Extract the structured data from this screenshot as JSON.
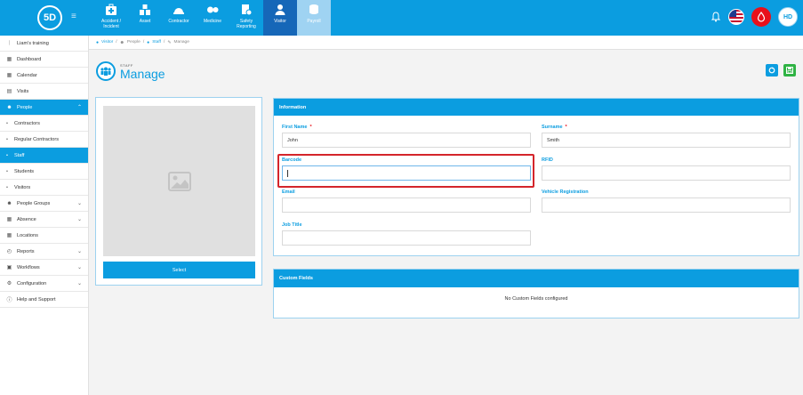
{
  "app": {
    "logo_text": "5D"
  },
  "modules": [
    {
      "id": "accident",
      "label_line1": "Accident /",
      "label_line2": "Incident"
    },
    {
      "id": "asset",
      "label_line1": "Asset",
      "label_line2": ""
    },
    {
      "id": "contractor",
      "label_line1": "Contractor",
      "label_line2": ""
    },
    {
      "id": "medicine",
      "label_line1": "Medicine",
      "label_line2": ""
    },
    {
      "id": "safety",
      "label_line1": "Safety",
      "label_line2": "Reporting"
    },
    {
      "id": "visitor",
      "label_line1": "Visitor",
      "label_line2": ""
    },
    {
      "id": "payroll",
      "label_line1": "Payroll",
      "label_line2": ""
    }
  ],
  "user": {
    "initials": "HD"
  },
  "sidebar": {
    "items": [
      {
        "label": "Liam's training",
        "icon": "branch-icon"
      },
      {
        "label": "Dashboard",
        "icon": "dashboard-icon"
      },
      {
        "label": "Calendar",
        "icon": "calendar-icon"
      },
      {
        "label": "Visits",
        "icon": "visits-icon"
      },
      {
        "label": "People",
        "icon": "people-icon"
      },
      {
        "label": "Contractors"
      },
      {
        "label": "Regular Contractors"
      },
      {
        "label": "Staff"
      },
      {
        "label": "Students"
      },
      {
        "label": "Visitors"
      },
      {
        "label": "People Groups",
        "icon": "groups-icon"
      },
      {
        "label": "Absence",
        "icon": "absence-icon"
      },
      {
        "label": "Locations",
        "icon": "locations-icon"
      },
      {
        "label": "Reports",
        "icon": "reports-icon"
      },
      {
        "label": "Workflows",
        "icon": "workflows-icon"
      },
      {
        "label": "Configuration",
        "icon": "configuration-icon"
      },
      {
        "label": "Help and Support",
        "icon": "help-icon"
      }
    ]
  },
  "breadcrumb": {
    "items": [
      "Visitor",
      "People",
      "Staff",
      "Manage"
    ],
    "separator": "/"
  },
  "page": {
    "super": "STAFF",
    "title": "Manage"
  },
  "photo": {
    "select_label": "Select"
  },
  "information": {
    "title": "Information",
    "first_name": {
      "label": "First Name",
      "required_mark": "*",
      "value": "John"
    },
    "surname": {
      "label": "Surname",
      "required_mark": "*",
      "value": "Smith"
    },
    "barcode": {
      "label": "Barcode",
      "value": ""
    },
    "rfid": {
      "label": "RFID",
      "value": ""
    },
    "email": {
      "label": "Email",
      "value": ""
    },
    "vehicle": {
      "label": "Vehicle Registration",
      "value": ""
    },
    "job_title": {
      "label": "Job Title",
      "value": ""
    }
  },
  "custom_fields": {
    "title": "Custom Fields",
    "empty_text": "No Custom Fields configured"
  },
  "colors": {
    "accent": "#0b9de0",
    "active_module": "#1667b8",
    "save": "#2fb344",
    "alert": "#e8101a",
    "highlight": "#d4252b"
  }
}
